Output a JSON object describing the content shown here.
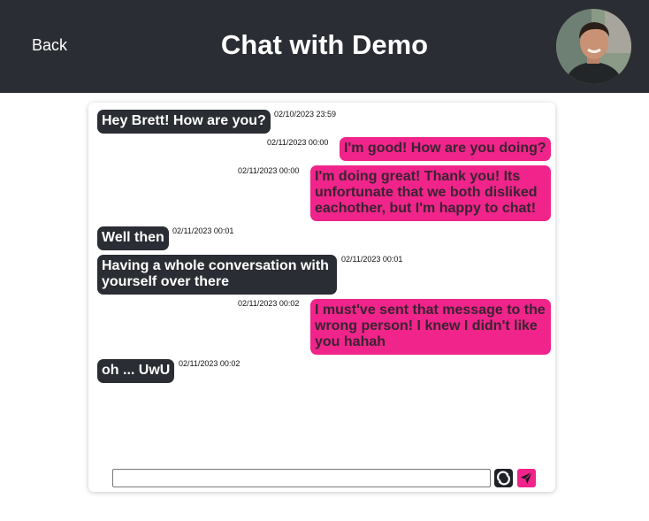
{
  "header": {
    "back_label": "Back",
    "title": "Chat with Demo",
    "avatar_icon": "user-avatar-photo"
  },
  "messages": [
    {
      "direction": "received",
      "text": "Hey Brett! How are you?",
      "timestamp": "02/10/2023 23:59"
    },
    {
      "direction": "sent",
      "text": "I'm good! How are you doing?",
      "timestamp": "02/11/2023 00:00"
    },
    {
      "direction": "sent",
      "text": "I'm doing great! Thank you! Its unfortunate that we both disliked eachother, but I'm happy to chat!",
      "timestamp": "02/11/2023 00:00"
    },
    {
      "direction": "received",
      "text": "Well then",
      "timestamp": "02/11/2023 00:01"
    },
    {
      "direction": "received",
      "text": "Having a whole conversation with yourself over there",
      "timestamp": "02/11/2023 00:01"
    },
    {
      "direction": "sent",
      "text": "I must've sent that message to the wrong person! I knew I didn't like you hahah",
      "timestamp": "02/11/2023 00:02"
    },
    {
      "direction": "received",
      "text": "oh ... UwU",
      "timestamp": "02/11/2023 00:02"
    }
  ],
  "composer": {
    "value": "",
    "refresh_icon": "refresh-icon",
    "send_icon": "send-icon"
  },
  "colors": {
    "header_bg": "#2a2d33",
    "received_bubble": "#2a2d33",
    "sent_bubble": "#f0248a"
  }
}
